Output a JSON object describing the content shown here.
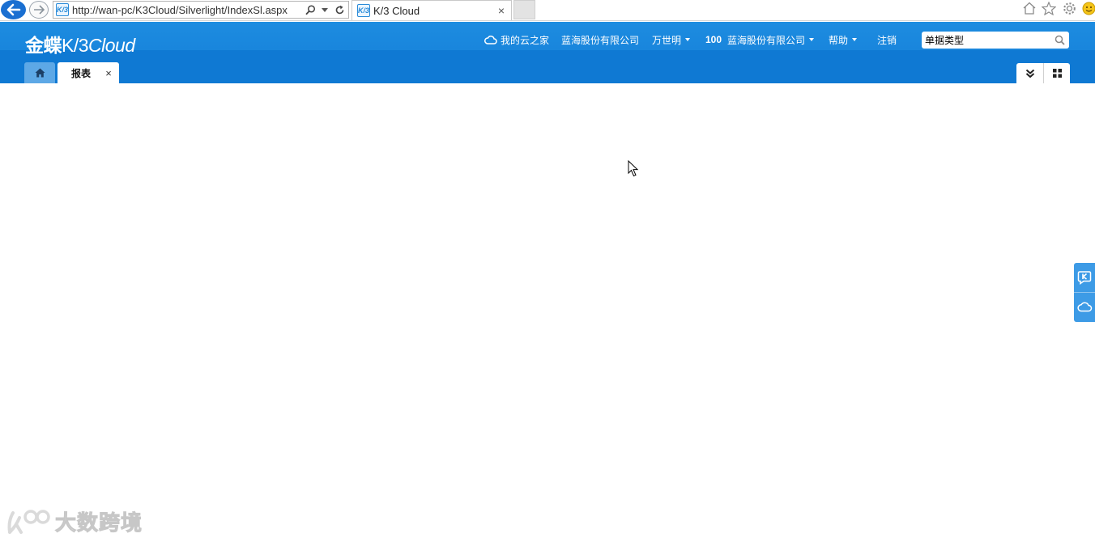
{
  "browser": {
    "url": "http://wan-pc/K3Cloud/Silverlight/IndexSl.aspx",
    "tab_title": "K/3 Cloud",
    "tab_close": "×",
    "favicon_text": "K/3"
  },
  "app": {
    "logo": {
      "cn": "金蝶",
      "k3": "K/3",
      "cloud": "Cloud"
    },
    "nav": {
      "cloud_home": "我的云之家",
      "company": "蓝海股份有限公司",
      "user": "万世明",
      "org_code": "100",
      "org_name": "蓝海股份有限公司",
      "help": "帮助",
      "logout": "注销"
    },
    "search": {
      "value": "单据类型"
    },
    "tabs": [
      {
        "label": "报表",
        "close": "×"
      }
    ]
  },
  "watermark": {
    "text": "大数跨境"
  },
  "colors": {
    "header_blue": "#1d8ce0",
    "tabbar_blue": "#0f79d3",
    "home_tab": "#5da8e6",
    "side_float": "#3d9be6"
  }
}
